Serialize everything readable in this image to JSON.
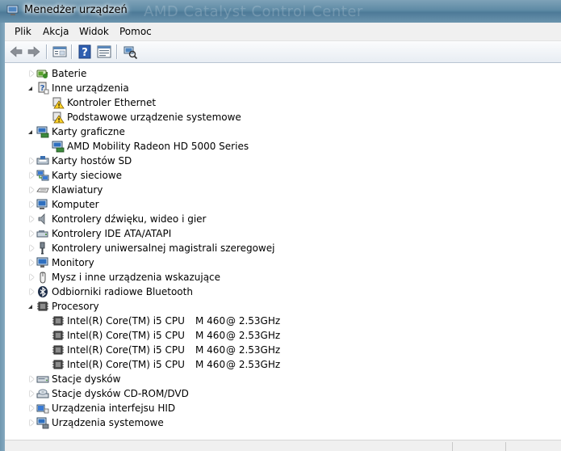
{
  "window": {
    "title": "Menedżer urządzeń",
    "background_title": "AMD Catalyst Control Center"
  },
  "menu": {
    "items": [
      "Plik",
      "Akcja",
      "Widok",
      "Pomoc"
    ]
  },
  "toolbar": {
    "buttons": [
      "back-arrow-icon",
      "forward-arrow-icon",
      "show-hide-tree-icon",
      "help-icon",
      "properties-icon",
      "scan-hardware-icon"
    ]
  },
  "tree": {
    "rows": [
      {
        "label": "Baterie",
        "level": 0,
        "expander": "collapsed",
        "icon": "battery-icon"
      },
      {
        "label": "Inne urządzenia",
        "level": 0,
        "expander": "expanded",
        "icon": "unknown-device-icon"
      },
      {
        "label": "Kontroler Ethernet",
        "level": 1,
        "expander": "none",
        "icon": "warning-device-icon"
      },
      {
        "label": "Podstawowe urządzenie systemowe",
        "level": 1,
        "expander": "none",
        "icon": "warning-device-icon"
      },
      {
        "label": "Karty graficzne",
        "level": 0,
        "expander": "expanded",
        "icon": "display-adapter-icon"
      },
      {
        "label": "AMD Mobility Radeon HD 5000 Series",
        "level": 1,
        "expander": "none",
        "icon": "display-adapter-icon"
      },
      {
        "label": "Karty hostów SD",
        "level": 0,
        "expander": "collapsed",
        "icon": "sd-host-icon"
      },
      {
        "label": "Karty sieciowe",
        "level": 0,
        "expander": "collapsed",
        "icon": "network-adapter-icon"
      },
      {
        "label": "Klawiatury",
        "level": 0,
        "expander": "collapsed",
        "icon": "keyboard-icon"
      },
      {
        "label": "Komputer",
        "level": 0,
        "expander": "collapsed",
        "icon": "computer-icon"
      },
      {
        "label": "Kontrolery dźwięku, wideo i gier",
        "level": 0,
        "expander": "collapsed",
        "icon": "speaker-icon"
      },
      {
        "label": "Kontrolery IDE ATA/ATAPI",
        "level": 0,
        "expander": "collapsed",
        "icon": "ide-controller-icon"
      },
      {
        "label": "Kontrolery uniwersalnej magistrali szeregowej",
        "level": 0,
        "expander": "collapsed",
        "icon": "usb-icon"
      },
      {
        "label": "Monitory",
        "level": 0,
        "expander": "collapsed",
        "icon": "monitor-icon"
      },
      {
        "label": "Mysz i inne urządzenia wskazujące",
        "level": 0,
        "expander": "collapsed",
        "icon": "mouse-icon"
      },
      {
        "label": "Odbiorniki radiowe Bluetooth",
        "level": 0,
        "expander": "collapsed",
        "icon": "bluetooth-icon"
      },
      {
        "label": "Procesory",
        "level": 0,
        "expander": "expanded",
        "icon": "processor-icon"
      },
      {
        "label": "Intel(R) Core(TM) i5 CPU",
        "model": "M 460",
        "freq": "@ 2.53GHz",
        "level": 1,
        "expander": "none",
        "icon": "processor-icon"
      },
      {
        "label": "Intel(R) Core(TM) i5 CPU",
        "model": "M 460",
        "freq": "@ 2.53GHz",
        "level": 1,
        "expander": "none",
        "icon": "processor-icon"
      },
      {
        "label": "Intel(R) Core(TM) i5 CPU",
        "model": "M 460",
        "freq": "@ 2.53GHz",
        "level": 1,
        "expander": "none",
        "icon": "processor-icon"
      },
      {
        "label": "Intel(R) Core(TM) i5 CPU",
        "model": "M 460",
        "freq": "@ 2.53GHz",
        "level": 1,
        "expander": "none",
        "icon": "processor-icon"
      },
      {
        "label": "Stacje dysków",
        "level": 0,
        "expander": "collapsed",
        "icon": "disk-drive-icon"
      },
      {
        "label": "Stacje dysków CD-ROM/DVD",
        "level": 0,
        "expander": "collapsed",
        "icon": "dvd-drive-icon"
      },
      {
        "label": "Urządzenia interfejsu HID",
        "level": 0,
        "expander": "collapsed",
        "icon": "hid-icon"
      },
      {
        "label": "Urządzenia systemowe",
        "level": 0,
        "expander": "collapsed",
        "icon": "system-devices-icon"
      }
    ]
  }
}
